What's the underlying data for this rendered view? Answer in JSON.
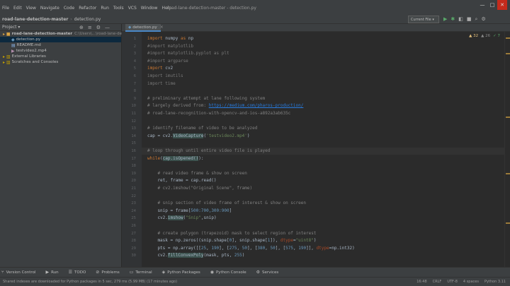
{
  "menu": {
    "items": [
      "File",
      "Edit",
      "View",
      "Navigate",
      "Code",
      "Refactor",
      "Run",
      "Tools",
      "VCS",
      "Window",
      "Help"
    ],
    "window_title": "road-lane-detection-master - detection.py"
  },
  "window_controls": {
    "minimize": "—",
    "maximize": "□",
    "close": "✕"
  },
  "navbar": {
    "breadcrumb_root": "road-lane-detection-master",
    "breadcrumb_file": "detection.py",
    "run_config": "Current File ▾"
  },
  "project": {
    "header_label": "Project ▾",
    "tree": [
      {
        "label": "road-lane-detection-master",
        "path": "C:\\Users\\...\\road-lane-detection-master",
        "kind": "folder",
        "indent": 0
      },
      {
        "label": "detection.py",
        "path": "",
        "kind": "py",
        "indent": 1
      },
      {
        "label": "README.md",
        "path": "",
        "kind": "md",
        "indent": 1
      },
      {
        "label": "testvideo2.mp4",
        "path": "",
        "kind": "mp4",
        "indent": 1
      },
      {
        "label": "External Libraries",
        "path": "",
        "kind": "lib",
        "indent": 0
      },
      {
        "label": "Scratches and Consoles",
        "path": "",
        "kind": "lib",
        "indent": 0
      }
    ]
  },
  "editor": {
    "tab_label": "detection.py",
    "inspections": {
      "warnings": "▲ 32",
      "weak": "▲ 26",
      "typos": "✓ 7"
    },
    "lines": [
      {
        "n": "1",
        "segs": [
          {
            "c": "kw",
            "t": "import "
          },
          {
            "c": "",
            "t": "numpy "
          },
          {
            "c": "kw",
            "t": "as "
          },
          {
            "c": "",
            "t": "np"
          }
        ]
      },
      {
        "n": "2",
        "segs": [
          {
            "c": "faded",
            "t": "#import matplotlib"
          }
        ]
      },
      {
        "n": "3",
        "segs": [
          {
            "c": "faded",
            "t": "#import matplotlib.pyplot as plt"
          }
        ]
      },
      {
        "n": "4",
        "segs": [
          {
            "c": "faded",
            "t": "#import argparse"
          }
        ]
      },
      {
        "n": "5",
        "segs": [
          {
            "c": "kw",
            "t": "import "
          },
          {
            "c": "",
            "t": "cv2"
          }
        ]
      },
      {
        "n": "6",
        "segs": [
          {
            "c": "faded",
            "t": "import imutils"
          }
        ]
      },
      {
        "n": "7",
        "segs": [
          {
            "c": "faded",
            "t": "import time"
          }
        ]
      },
      {
        "n": "8",
        "segs": []
      },
      {
        "n": "9",
        "segs": [
          {
            "c": "cm",
            "t": "# preliminary attempt at lane following system"
          }
        ]
      },
      {
        "n": "10",
        "segs": [
          {
            "c": "cm",
            "t": "# largely derived from: "
          },
          {
            "c": "link",
            "t": "https://medium.com/pharos-production/"
          }
        ]
      },
      {
        "n": "11",
        "segs": [
          {
            "c": "cm",
            "t": "# road-lane-recognition-with-opencv-and-ios-a892a3ab635c"
          }
        ]
      },
      {
        "n": "12",
        "segs": []
      },
      {
        "n": "13",
        "segs": [
          {
            "c": "cm",
            "t": "# identify filename of video to be analyzed"
          }
        ]
      },
      {
        "n": "14",
        "segs": [
          {
            "c": "",
            "t": "cap = cv2."
          },
          {
            "c": "hl",
            "t": "VideoCapture"
          },
          {
            "c": "",
            "t": "("
          },
          {
            "c": "str",
            "t": "'testvideo2.mp4'"
          },
          {
            "c": "",
            "t": ")"
          }
        ]
      },
      {
        "n": "15",
        "segs": []
      },
      {
        "n": "16",
        "segs": [
          {
            "c": "cm",
            "t": "# loop through until entire video file is played"
          }
        ]
      },
      {
        "n": "17",
        "segs": [
          {
            "c": "kw",
            "t": "while"
          },
          {
            "c": "",
            "t": "("
          },
          {
            "c": "hl",
            "t": "cap.isOpened()"
          },
          {
            "c": "",
            "t": "):"
          }
        ]
      },
      {
        "n": "18",
        "segs": []
      },
      {
        "n": "19",
        "segs": [
          {
            "c": "cm",
            "t": "    # read video frame & show on screen"
          }
        ]
      },
      {
        "n": "20",
        "segs": [
          {
            "c": "",
            "t": "    ret, frame = cap.read()"
          }
        ]
      },
      {
        "n": "21",
        "segs": [
          {
            "c": "cm",
            "t": "    # cv2.imshow(\"Original Scene\", frame)"
          }
        ]
      },
      {
        "n": "22",
        "segs": []
      },
      {
        "n": "23",
        "segs": [
          {
            "c": "cm",
            "t": "    # snip section of video frame of interest & show on screen"
          }
        ]
      },
      {
        "n": "24",
        "segs": [
          {
            "c": "",
            "t": "    snip = frame["
          },
          {
            "c": "num",
            "t": "500:700,300:900"
          },
          {
            "c": "",
            "t": "]"
          }
        ]
      },
      {
        "n": "25",
        "segs": [
          {
            "c": "",
            "t": "    cv2."
          },
          {
            "c": "hl",
            "t": "imshow"
          },
          {
            "c": "",
            "t": "("
          },
          {
            "c": "str",
            "t": "\"Snip\""
          },
          {
            "c": "",
            "t": ",snip)"
          }
        ]
      },
      {
        "n": "26",
        "segs": []
      },
      {
        "n": "27",
        "segs": [
          {
            "c": "cm",
            "t": "    # create polygon (trapezoid) mask to select region of interest"
          }
        ]
      },
      {
        "n": "28",
        "segs": [
          {
            "c": "",
            "t": "    mask = np.zeros((snip.shape["
          },
          {
            "c": "num",
            "t": "0"
          },
          {
            "c": "",
            "t": "], snip.shape["
          },
          {
            "c": "num",
            "t": "1"
          },
          {
            "c": "",
            "t": "]), "
          },
          {
            "c": "kwarg",
            "t": "dtype"
          },
          {
            "c": "",
            "t": "="
          },
          {
            "c": "str",
            "t": "\"uint8\""
          },
          {
            "c": "",
            "t": ")"
          }
        ]
      },
      {
        "n": "29",
        "segs": [
          {
            "c": "",
            "t": "    pts = np.array([["
          },
          {
            "c": "num",
            "t": "25"
          },
          {
            "c": "",
            "t": ", "
          },
          {
            "c": "num",
            "t": "190"
          },
          {
            "c": "",
            "t": "], ["
          },
          {
            "c": "num",
            "t": "275"
          },
          {
            "c": "",
            "t": ", "
          },
          {
            "c": "num",
            "t": "50"
          },
          {
            "c": "",
            "t": "], ["
          },
          {
            "c": "num",
            "t": "380"
          },
          {
            "c": "",
            "t": ", "
          },
          {
            "c": "num",
            "t": "50"
          },
          {
            "c": "",
            "t": "], ["
          },
          {
            "c": "num",
            "t": "575"
          },
          {
            "c": "",
            "t": ", "
          },
          {
            "c": "num",
            "t": "190"
          },
          {
            "c": "",
            "t": "]], "
          },
          {
            "c": "kwarg",
            "t": "dtype"
          },
          {
            "c": "",
            "t": "=np.int32)"
          }
        ]
      },
      {
        "n": "30",
        "segs": [
          {
            "c": "",
            "t": "    cv2."
          },
          {
            "c": "hl",
            "t": "fillConvexPoly"
          },
          {
            "c": "",
            "t": "(mask, pts, "
          },
          {
            "c": "num",
            "t": "255"
          },
          {
            "c": "",
            "t": ")"
          }
        ]
      }
    ]
  },
  "toolwindows": [
    {
      "label": "Version Control",
      "icon": "⑂"
    },
    {
      "label": "Run",
      "icon": "▶"
    },
    {
      "label": "TODO",
      "icon": "☰"
    },
    {
      "label": "Problems",
      "icon": "⊘"
    },
    {
      "label": "Terminal",
      "icon": "▭"
    },
    {
      "label": "Python Packages",
      "icon": "◈"
    },
    {
      "label": "Python Console",
      "icon": "◉"
    },
    {
      "label": "Services",
      "icon": "⚙"
    }
  ],
  "status": {
    "message": "Shared indexes are downloaded for Python packages in 5 sec, 279 ms (5.99 MB) (17 minutes ago)",
    "position": "16:48",
    "line_sep": "CRLF",
    "encoding": "UTF-8",
    "indent": "4 spaces",
    "interpreter": "Python 3.11"
  },
  "colors": {
    "accent": "#4a88c7",
    "background": "#2b2b2b",
    "panel": "#3c3f41"
  }
}
